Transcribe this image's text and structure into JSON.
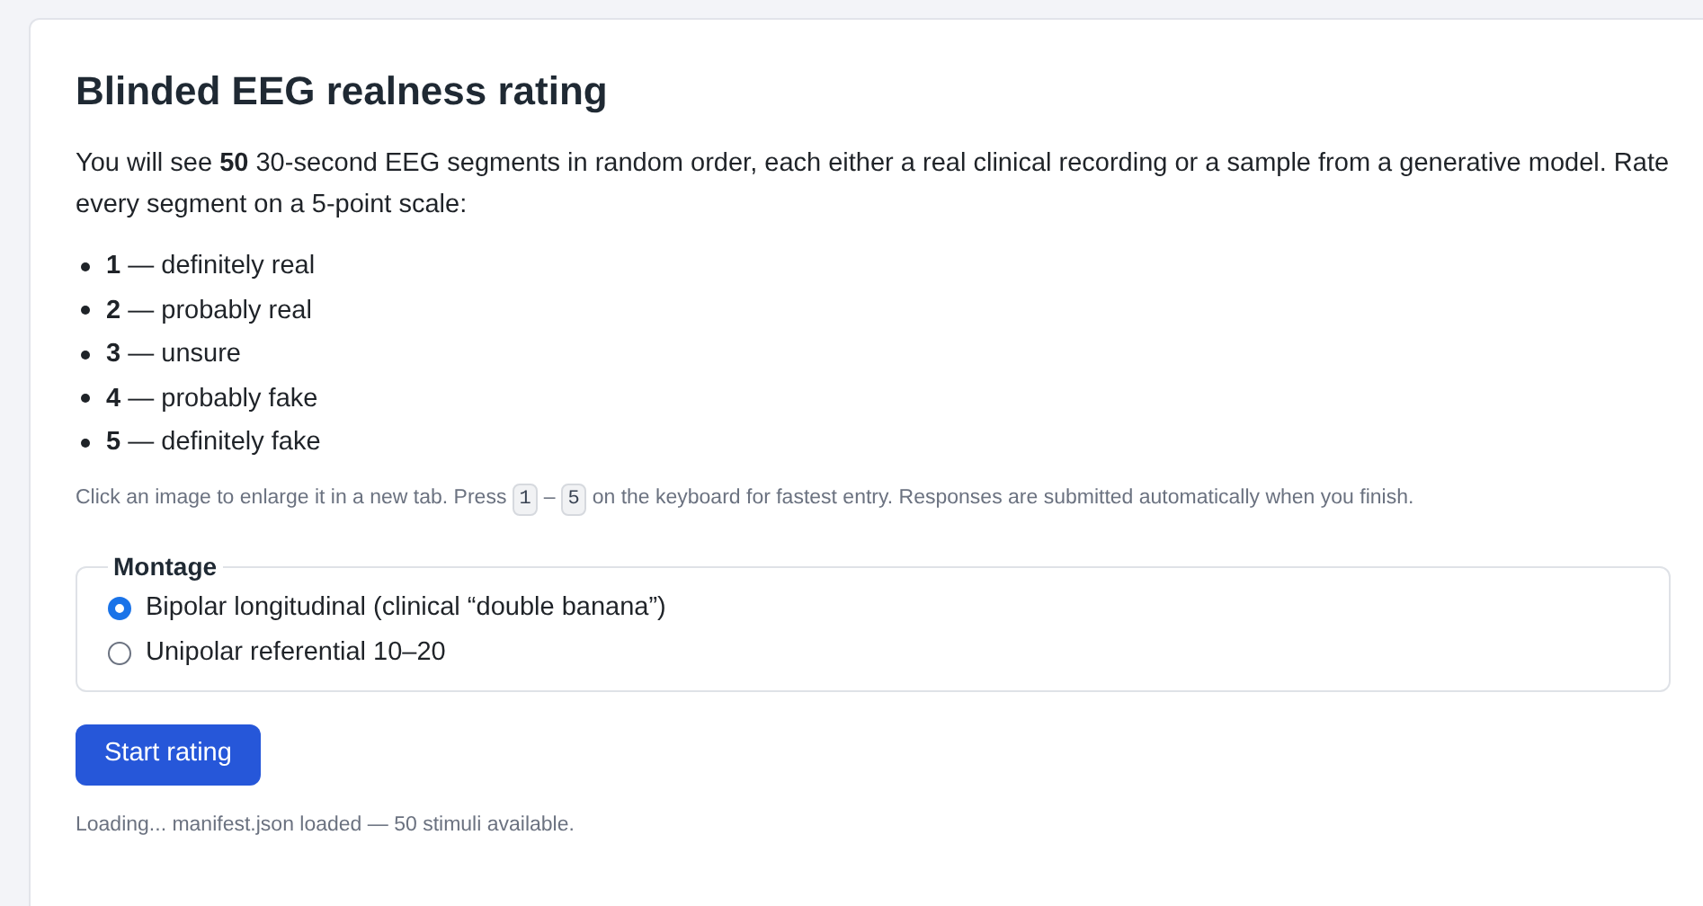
{
  "title": "Blinded EEG realness rating",
  "intro": "You will see **50** 30-second EEG segments in random order, each either a real clinical recording or a sample from a generative model. Rate every segment on a 5-point scale:",
  "scale": [
    "**1** — definitely real",
    "**2** — probably real",
    "**3** — unsure",
    "**4** — probably fake",
    "**5** — definitely fake"
  ],
  "hint": {
    "before": "Click an image to enlarge it in a new tab. Press",
    "key_from": "1",
    "separator": "–",
    "key_to": "5",
    "after": "on the keyboard for fastest entry. Responses are submitted automatically when you finish."
  },
  "montage": {
    "legend": "Montage",
    "options": [
      {
        "label": "Bipolar longitudinal (clinical “double banana”)",
        "selected": true
      },
      {
        "label": "Unipolar referential 10–20",
        "selected": false
      }
    ]
  },
  "button": "Start rating",
  "status": "Loading... manifest.json loaded — 50 stimuli available."
}
